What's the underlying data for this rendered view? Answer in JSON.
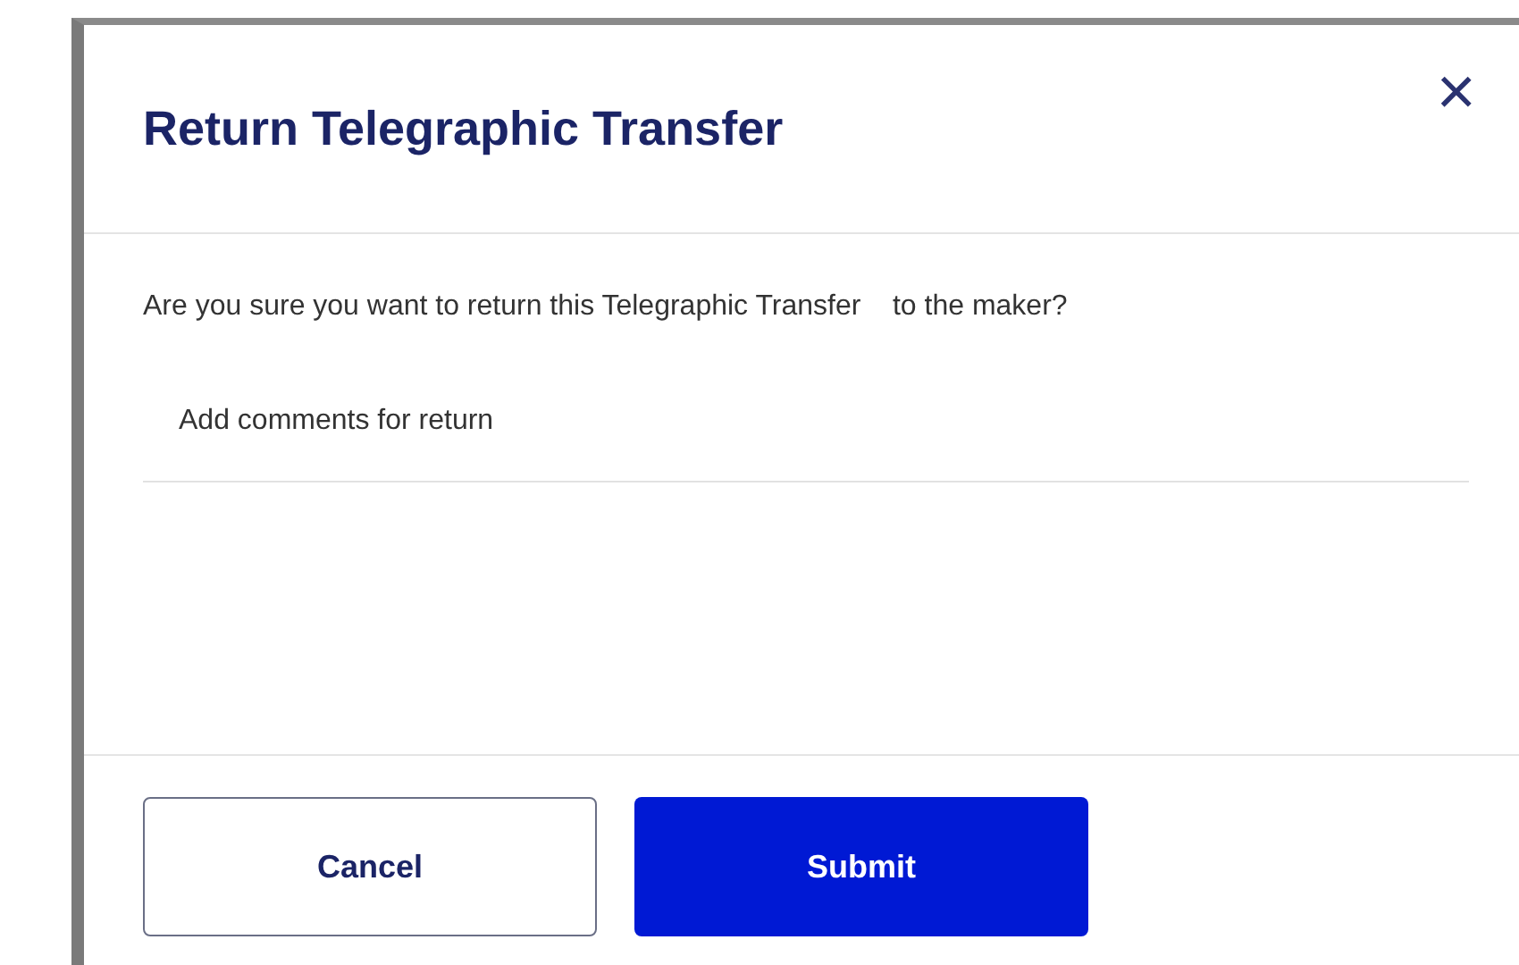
{
  "dialog": {
    "title": "Return Telegraphic Transfer",
    "close": "×",
    "message": "Are you sure you want to return this Telegraphic Transfer    to the maker?",
    "comment_field": {
      "placeholder": "Add comments for return"
    },
    "buttons": [
      {
        "label": "Cancel",
        "kind": "secondary"
      },
      {
        "label": "Submit",
        "kind": "primary"
      }
    ]
  }
}
